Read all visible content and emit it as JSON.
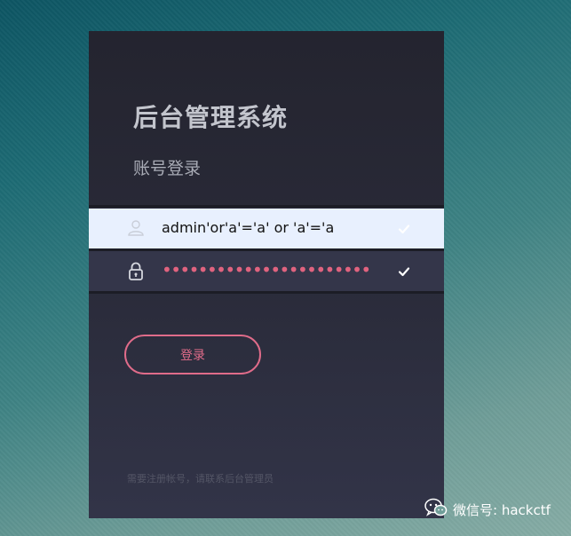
{
  "login": {
    "title": "后台管理系统",
    "subtitle": "账号登录",
    "username": {
      "value": "admin'or'a'='a' or 'a'='a",
      "icon": "user-icon",
      "status_icon": "check-icon"
    },
    "password": {
      "masked_value": "•••••••••••••••••••••••",
      "icon": "lock-icon",
      "status_icon": "check-icon"
    },
    "submit_label": "登录",
    "register_hint": "需要注册帐号，请联系后台管理员"
  },
  "watermark": {
    "text": "微信号: hackctf",
    "icon": "wechat-icon"
  },
  "colors": {
    "panel": "#292a38",
    "accent": "#e06c8a",
    "autofill": "#e8f0fe"
  }
}
